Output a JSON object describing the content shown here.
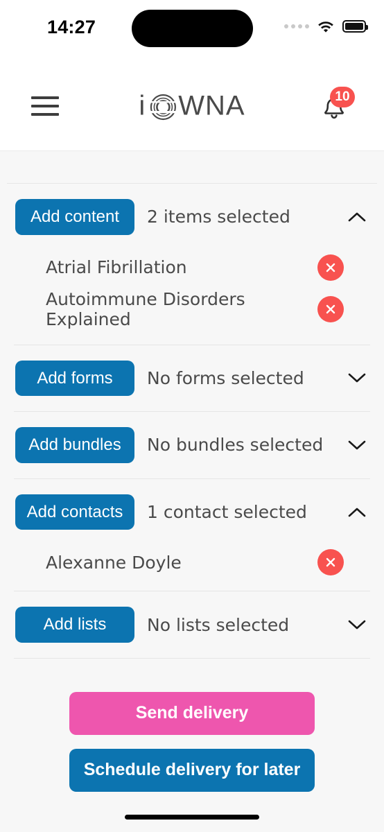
{
  "status_bar": {
    "time": "14:27",
    "signal_icon": "signal-dots-icon",
    "wifi_icon": "wifi-icon",
    "battery_icon": "battery-full-icon"
  },
  "header": {
    "menu_icon": "hamburger-menu-icon",
    "logo_text_left": "i",
    "logo_text_right": "WNA",
    "logo_mark": "concentric-circle-o-icon",
    "notifications_icon": "bell-icon",
    "notification_count": "10"
  },
  "colors": {
    "primary_blue": "#0c74b0",
    "accent_pink": "#ee56ae",
    "danger_red": "#f8524f",
    "page_background": "#f7f7f7",
    "text": "#4a4a4a"
  },
  "sections": [
    {
      "key": "content",
      "button_label": "Add content",
      "summary": "2 items selected",
      "expanded": true,
      "chevron": "chevron-up-icon",
      "items": [
        {
          "name": "Atrial Fibrillation",
          "remove_icon": "remove-x-icon"
        },
        {
          "name": "Autoimmune Disorders Explained",
          "remove_icon": "remove-x-icon"
        }
      ]
    },
    {
      "key": "forms",
      "button_label": "Add forms",
      "summary": "No forms selected",
      "expanded": false,
      "chevron": "chevron-down-icon",
      "items": []
    },
    {
      "key": "bundles",
      "button_label": "Add bundles",
      "summary": "No bundles selected",
      "expanded": false,
      "chevron": "chevron-down-icon",
      "items": []
    },
    {
      "key": "contacts",
      "button_label": "Add contacts",
      "summary": "1 contact selected",
      "expanded": true,
      "chevron": "chevron-up-icon",
      "items": [
        {
          "name": "Alexanne Doyle",
          "remove_icon": "remove-x-icon"
        }
      ]
    },
    {
      "key": "lists",
      "button_label": "Add lists",
      "summary": "No lists selected",
      "expanded": false,
      "chevron": "chevron-down-icon",
      "items": []
    }
  ],
  "actions": {
    "send_label": "Send delivery",
    "schedule_label": "Schedule delivery for later"
  }
}
